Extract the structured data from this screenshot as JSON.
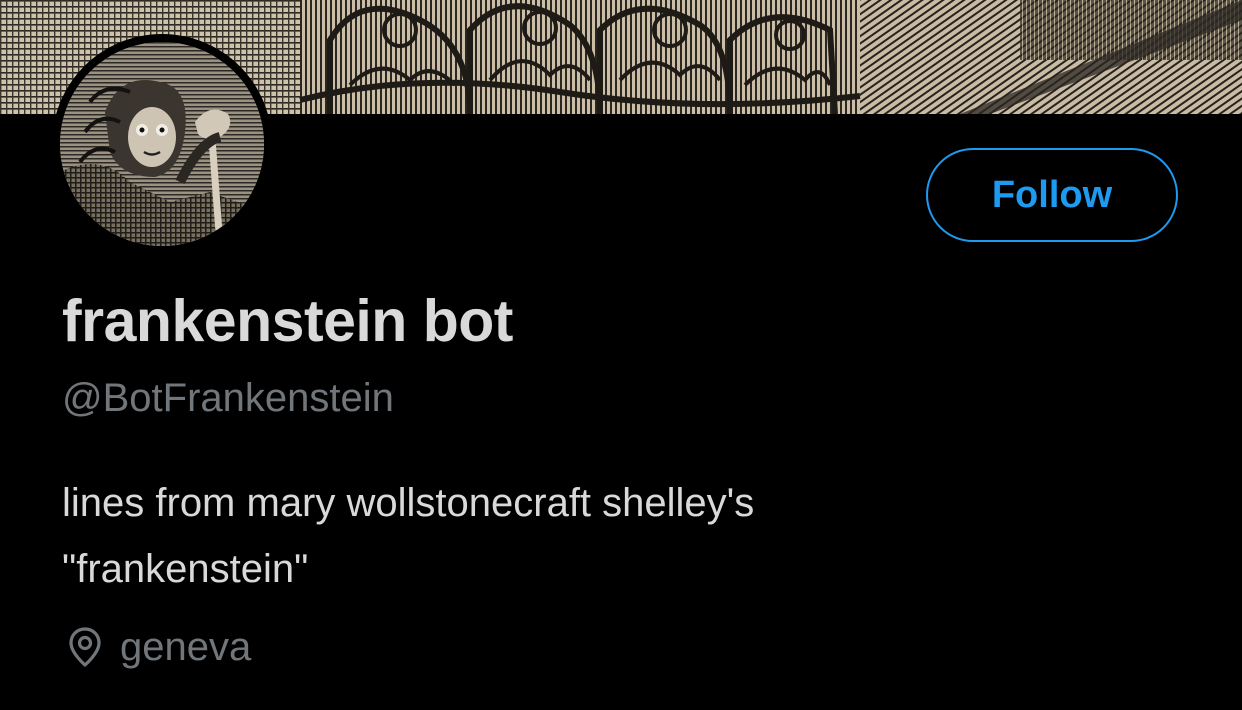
{
  "profile": {
    "display_name": "frankenstein bot",
    "handle": "@BotFrankenstein",
    "bio_lines": [
      "lines from mary wollstonecraft shelley's",
      "\"frankenstein\""
    ],
    "location": "geneva"
  },
  "actions": {
    "follow_label": "Follow"
  },
  "icons": {
    "location": "map-pin-icon"
  },
  "colors": {
    "background": "#000000",
    "accent": "#1d9bf0",
    "primary_text": "#d9d9d9",
    "secondary_text": "#71767b",
    "banner_paper": "#cdbfa9"
  }
}
